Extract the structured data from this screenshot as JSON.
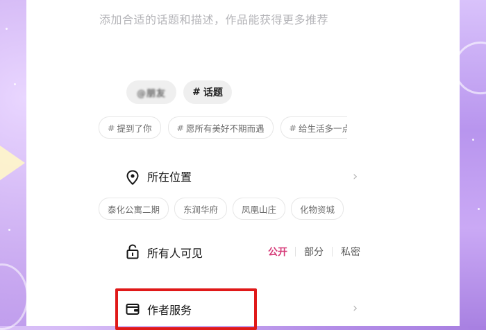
{
  "description": {
    "placeholder": "添加合适的话题和描述，作品能获得更多推荐"
  },
  "tag_buttons": {
    "friend_button_label": "@朋友",
    "topic_button_label": "话题",
    "hash_symbol": "#"
  },
  "topic_suggestions": [
    "提到了你",
    "愿所有美好不期而遇",
    "给生活多一点"
  ],
  "location": {
    "label": "所在位置",
    "suggestions": [
      "泰化公寓二期",
      "东润华府",
      "凤凰山庄",
      "化物资城"
    ]
  },
  "visibility": {
    "label": "所有人可见",
    "options": [
      "公开",
      "部分",
      "私密"
    ],
    "selected": "公开"
  },
  "author_service": {
    "label": "作者服务"
  },
  "colors": {
    "accent": "#d63a78",
    "highlight_box": "#e01919"
  }
}
